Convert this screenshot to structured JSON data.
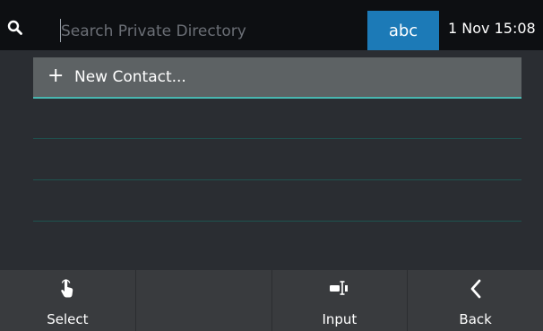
{
  "topbar": {
    "search_placeholder": "Search Private Directory",
    "search_value": "",
    "input_mode": "abc",
    "datetime": "1 Nov 15:08"
  },
  "list": {
    "new_contact_label": "New Contact..."
  },
  "softkeys": [
    {
      "label": "Select",
      "icon": "tap-hand-icon"
    },
    {
      "label": "",
      "icon": ""
    },
    {
      "label": "Input",
      "icon": "text-cursor-icon"
    },
    {
      "label": "Back",
      "icon": "chevron-left-icon"
    }
  ],
  "colors": {
    "topbar_bg": "#0d0f12",
    "body_bg": "#2a2d32",
    "accent": "#1c7ab7",
    "selection_line": "#48b6b0",
    "softkey_bg": "#393b3e"
  }
}
